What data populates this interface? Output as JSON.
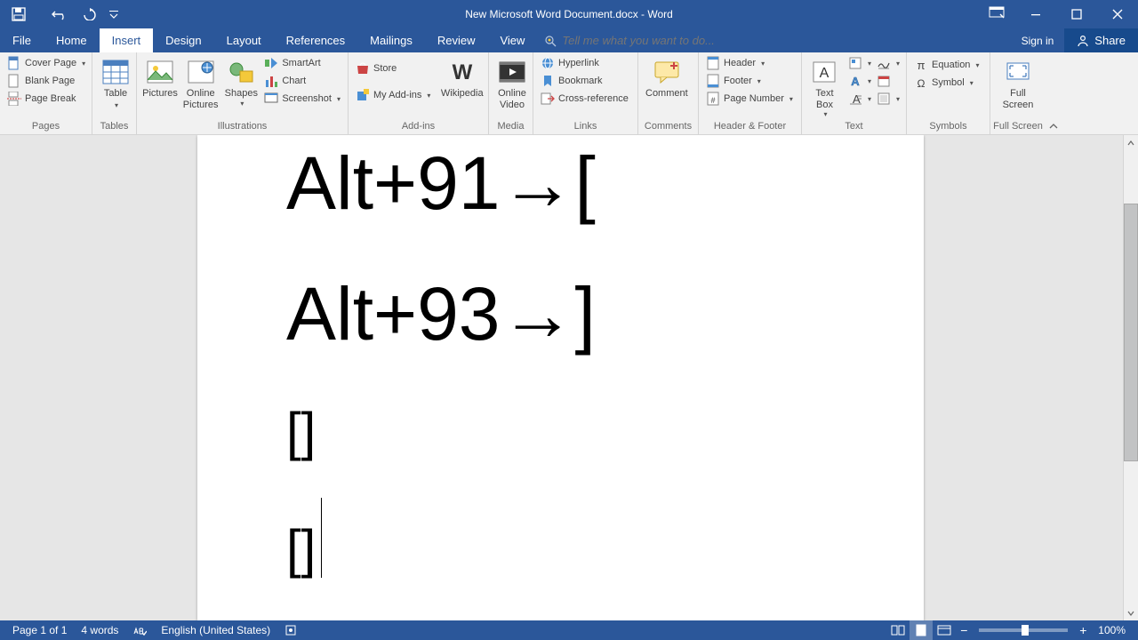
{
  "title": "New Microsoft Word Document.docx - Word",
  "tabs": {
    "file": "File",
    "home": "Home",
    "insert": "Insert",
    "design": "Design",
    "layout": "Layout",
    "references": "References",
    "mailings": "Mailings",
    "review": "Review",
    "view": "View"
  },
  "tell_me_placeholder": "Tell me what you want to do...",
  "signin": "Sign in",
  "share": "Share",
  "ribbon": {
    "pages": {
      "cover": "Cover Page",
      "blank": "Blank Page",
      "break": "Page Break",
      "label": "Pages"
    },
    "tables": {
      "table": "Table",
      "label": "Tables"
    },
    "illus": {
      "pictures": "Pictures",
      "online": "Online Pictures",
      "shapes": "Shapes",
      "smartart": "SmartArt",
      "chart": "Chart",
      "screenshot": "Screenshot",
      "label": "Illustrations"
    },
    "addins": {
      "store": "Store",
      "my": "My Add-ins",
      "wiki": "Wikipedia",
      "label": "Add-ins"
    },
    "media": {
      "video": "Online Video",
      "label": "Media"
    },
    "links": {
      "hyper": "Hyperlink",
      "book": "Bookmark",
      "cross": "Cross-reference",
      "label": "Links"
    },
    "comments": {
      "comment": "Comment",
      "label": "Comments"
    },
    "hf": {
      "header": "Header",
      "footer": "Footer",
      "pagenum": "Page Number",
      "label": "Header & Footer"
    },
    "text": {
      "textbox": "Text Box",
      "label": "Text"
    },
    "symbols": {
      "equation": "Equation",
      "symbol": "Symbol",
      "label": "Symbols"
    },
    "full": {
      "full": "Full Screen",
      "label": "Full Screen"
    }
  },
  "document": {
    "line1": "Alt+91→[",
    "line2": "Alt+93→]",
    "line3": "[]",
    "line4": "[]"
  },
  "status": {
    "page": "Page 1 of 1",
    "words": "4 words",
    "lang": "English (United States)",
    "zoom": "100%"
  }
}
